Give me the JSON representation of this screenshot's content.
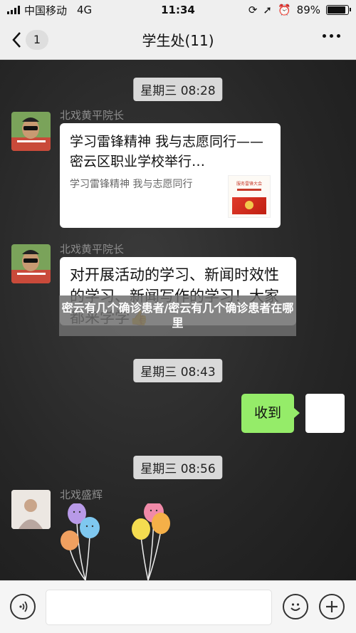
{
  "status": {
    "carrier": "中国移动",
    "network": "4G",
    "time": "11:34",
    "battery": "89%",
    "battery_level": 0.89
  },
  "nav": {
    "unread_count": "1",
    "title": "学生处(11)"
  },
  "messages": [
    {
      "timestamp": "星期三 08:28",
      "sender": "北戏黄平院长",
      "card_title": "学习雷锋精神 我与志愿同行——密云区职业学校举行…",
      "card_desc": "学习雷锋精神 我与志愿同行",
      "thumb_text": "服务雷锋大会"
    },
    {
      "sender": "北戏黄平院长",
      "text": "对开展活动的学习、新闻时效性的学习、新闻写作的学习！大家都来学学👍"
    },
    {
      "timestamp": "星期三 08:43",
      "mine_text": "收到"
    },
    {
      "timestamp": "星期三 08:56",
      "sender": "北戏盛辉"
    }
  ],
  "overlay": {
    "text": "密云有几个确诊患者/密云有几个确诊患者在哪里"
  },
  "colors": {
    "mine_bubble": "#95ec69",
    "chat_bg": "#2a2a2a",
    "stamp_bg": "#d9d9d9"
  }
}
